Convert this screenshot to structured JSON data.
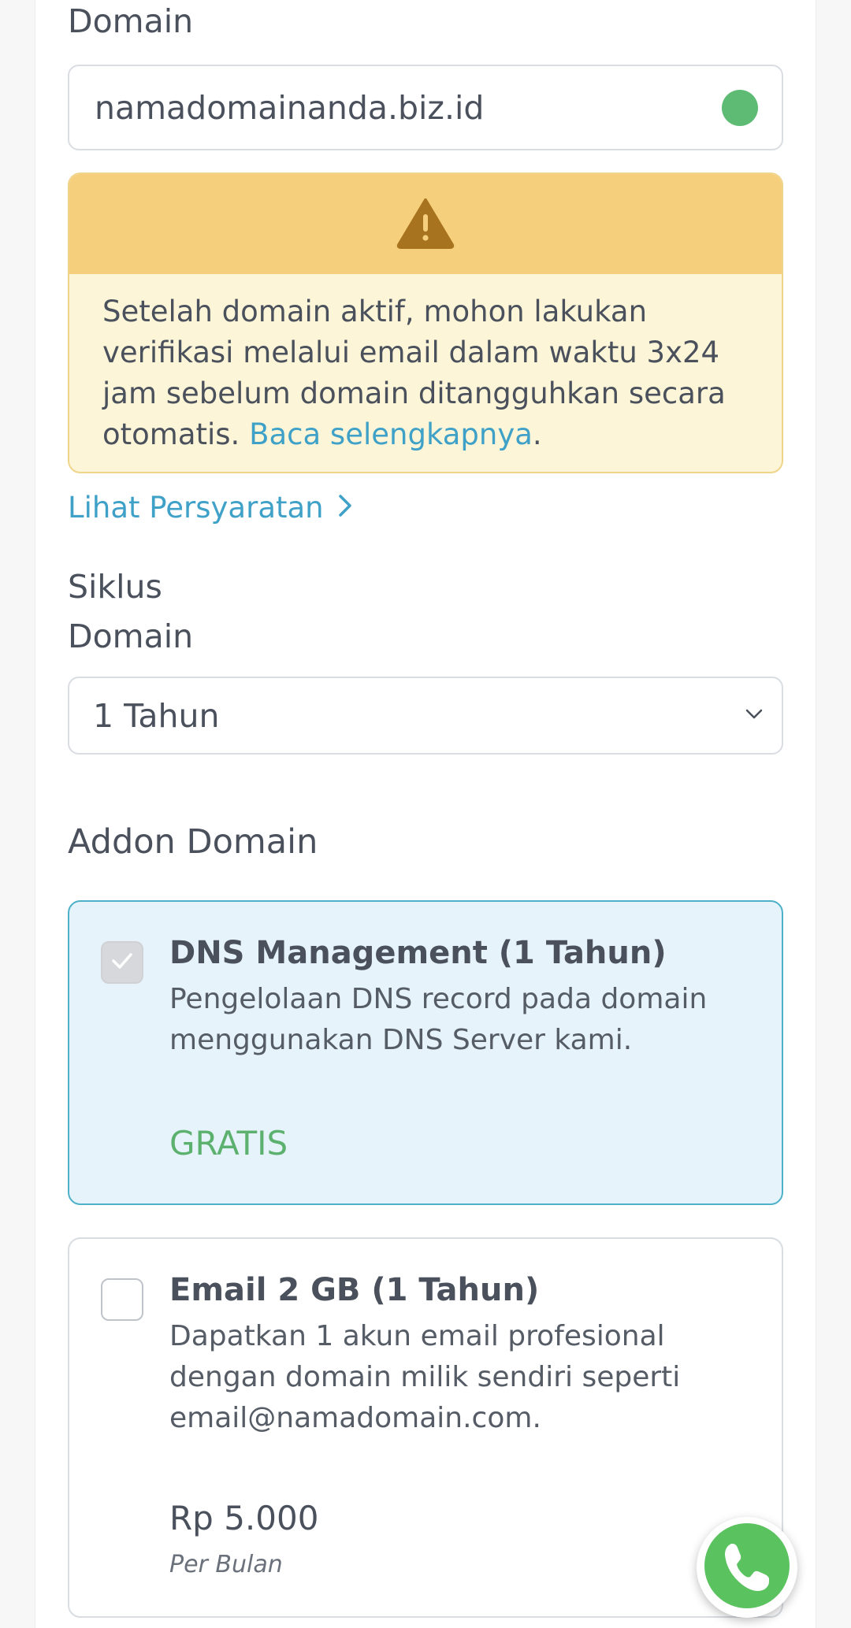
{
  "domain": {
    "label": "Domain",
    "value": "namadomainanda.biz.id",
    "status_color": "#5dbb74"
  },
  "alert": {
    "icon": "warning-triangle-icon",
    "text": "Setelah domain aktif, mohon lakukan verifikasi melalui email dalam waktu 3x24 jam sebelum domain ditangguhkan secara otomatis. ",
    "link_text": "Baca selengkapnya",
    "suffix": "."
  },
  "terms_link": {
    "label": "Lihat Persyaratan",
    "icon": "chevron-right-icon"
  },
  "cycle": {
    "label_line1": "Siklus",
    "label_line2": "Domain",
    "selected": "1 Tahun"
  },
  "addons": {
    "title": "Addon Domain",
    "items": [
      {
        "name": "DNS Management (1 Tahun)",
        "description": "Pengelolaan DNS record pada domain menggunakan DNS Server kami.",
        "price": "GRATIS",
        "checked": true
      },
      {
        "name": "Email 2 GB (1 Tahun)",
        "description": "Dapatkan 1 akun email profesional dengan domain milik sendiri seperti email@namadomain.com.",
        "price": "Rp 5.000",
        "period": "Per Bulan",
        "checked": false
      }
    ]
  },
  "colors": {
    "accent_link": "#3fa1c8",
    "free_price": "#5db16f",
    "alert_header": "#f5cf7c",
    "alert_body": "#fcf5d7",
    "selected_addon_bg": "#e6f3fb"
  },
  "whatsapp": {
    "icon": "whatsapp-icon"
  }
}
